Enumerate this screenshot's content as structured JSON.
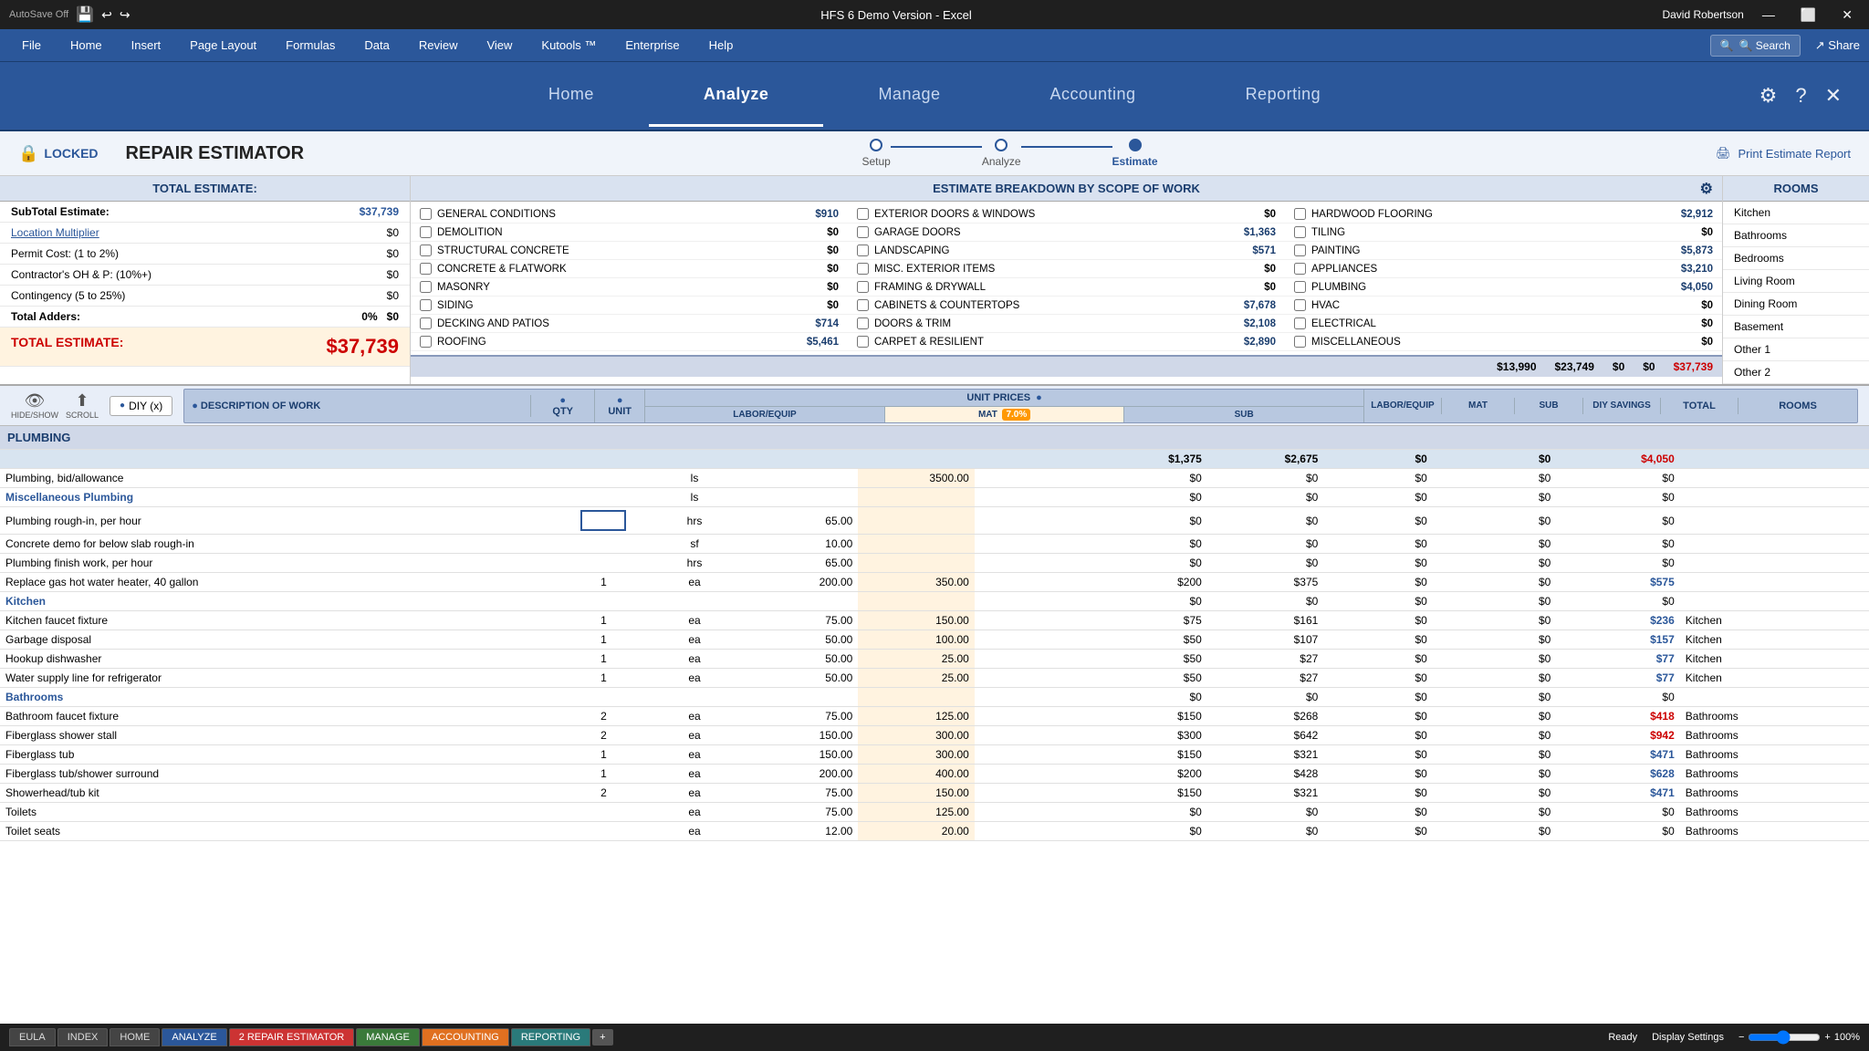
{
  "titlebar": {
    "autosave": "AutoSave  Off",
    "title": "HFS 6 Demo Version - Excel",
    "user": "David Robertson"
  },
  "ribbon": {
    "tabs": [
      "File",
      "Home",
      "Insert",
      "Page Layout",
      "Formulas",
      "Data",
      "Review",
      "View",
      "Kutools ™",
      "Enterprise",
      "Help"
    ],
    "search_placeholder": "Search",
    "search_label": "🔍 Search"
  },
  "app_nav": {
    "tabs": [
      "Home",
      "Analyze",
      "Manage",
      "Accounting",
      "Reporting"
    ],
    "active_tab": "Analyze",
    "icons": [
      "⚙",
      "?",
      "✕"
    ]
  },
  "header": {
    "locked_label": "LOCKED",
    "title": "REPAIR ESTIMATOR",
    "steps": [
      "Setup",
      "Analyze",
      "Estimate"
    ],
    "active_step": "Estimate",
    "print_label": "Print Estimate Report"
  },
  "summary": {
    "header": "TOTAL ESTIMATE:",
    "rows": [
      {
        "label": "SubTotal Estimate:",
        "value": "$37,739",
        "bold": true
      },
      {
        "label": "Location Multiplier",
        "value": "$0",
        "link": true
      },
      {
        "label": "Permit Cost: (1 to 2%)",
        "value": "$0"
      },
      {
        "label": "Contractor's  OH & P: (10%+)",
        "value": "$0"
      },
      {
        "label": "Contingency (5 to 25%)",
        "value": "$0"
      },
      {
        "label": "Total Adders:",
        "value": "0%   $0",
        "bold": true
      },
      {
        "label": "TOTAL ESTIMATE:",
        "value": "$37,739",
        "total": true
      }
    ]
  },
  "estimate_breakdown": {
    "header": "ESTIMATE BREAKDOWN BY SCOPE OF WORK",
    "items": [
      {
        "label": "GENERAL CONDITIONS",
        "value": "$910",
        "checked": false
      },
      {
        "label": "EXTERIOR DOORS & WINDOWS",
        "value": "$0",
        "checked": false
      },
      {
        "label": "HARDWOOD FLOORING",
        "value": "$2,912",
        "checked": false
      },
      {
        "label": "DEMOLITION",
        "value": "$0",
        "checked": false
      },
      {
        "label": "GARAGE DOORS",
        "value": "$1,363",
        "checked": false
      },
      {
        "label": "TILING",
        "value": "$0",
        "checked": false
      },
      {
        "label": "STRUCTURAL CONCRETE",
        "value": "$0",
        "checked": false
      },
      {
        "label": "LANDSCAPING",
        "value": "$571",
        "checked": false
      },
      {
        "label": "PAINTING",
        "value": "$5,873",
        "checked": false
      },
      {
        "label": "CONCRETE & FLATWORK",
        "value": "$0",
        "checked": false
      },
      {
        "label": "MISC. EXTERIOR ITEMS",
        "value": "$0",
        "checked": false
      },
      {
        "label": "APPLIANCES",
        "value": "$3,210",
        "checked": false
      },
      {
        "label": "MASONRY",
        "value": "$0",
        "checked": false
      },
      {
        "label": "FRAMING & DRYWALL",
        "value": "$0",
        "checked": false
      },
      {
        "label": "PLUMBING",
        "value": "$4,050",
        "checked": false
      },
      {
        "label": "SIDING",
        "value": "$0",
        "checked": false
      },
      {
        "label": "CABINETS & COUNTERTOPS",
        "value": "$7,678",
        "checked": false
      },
      {
        "label": "HVAC",
        "value": "$0",
        "checked": false
      },
      {
        "label": "DECKING AND PATIOS",
        "value": "$714",
        "checked": false
      },
      {
        "label": "DOORS & TRIM",
        "value": "$2,108",
        "checked": false
      },
      {
        "label": "ELECTRICAL",
        "value": "$0",
        "checked": false
      },
      {
        "label": "ROOFING",
        "value": "$5,461",
        "checked": false
      },
      {
        "label": "CARPET & RESILIENT",
        "value": "$2,890",
        "checked": false
      },
      {
        "label": "MISCELLANEOUS",
        "value": "$0",
        "checked": false
      }
    ],
    "totals": [
      "$13,990",
      "$23,749",
      "$0",
      "$0",
      "$37,739"
    ]
  },
  "rooms": {
    "header": "ROOMS",
    "items": [
      "Kitchen",
      "Bathrooms",
      "Bedrooms",
      "Living Room",
      "Dining Room",
      "Basement",
      "Other 1",
      "Other 2"
    ]
  },
  "toolbar": {
    "hide_show": "HIDE/SHOW",
    "scroll": "SCROLL",
    "diy_label": "DIY (x)",
    "desc_header": "DESCRIPTION OF WORK",
    "qty_header": "QTY",
    "unit_header": "UNIT",
    "unit_prices_header": "UNIT PRICES",
    "labor_equip_header": "LABOR/EQUIP",
    "mat_header": "MAT",
    "mat_pct": "7.0%",
    "sub_header": "SUB",
    "labor_equip2": "LABOR/EQUIP",
    "mat2": "MAT",
    "sub2": "SUB",
    "diy_savings": "DIY SAVINGS",
    "total": "TOTAL",
    "rooms2": "ROOMS"
  },
  "plumbing": {
    "section_label": "PLUMBING",
    "totals": {
      "labor": "$1,375",
      "mat": "$2,675",
      "sub": "$0",
      "diy": "$0",
      "total": "$4,050"
    },
    "rows": [
      {
        "desc": "Plumbing, bid/allowance",
        "qty": "",
        "unit": "ls",
        "le": "",
        "mat": "3500.00",
        "sub": "",
        "labor": "$0",
        "matv": "$0",
        "subv": "$0",
        "diyv": "$0",
        "totalv": "$0",
        "room": ""
      },
      {
        "desc": "Miscellaneous Plumbing",
        "qty": "",
        "unit": "ls",
        "le": "",
        "mat": "",
        "sub": "",
        "labor": "$0",
        "matv": "$0",
        "subv": "$0",
        "diyv": "$0",
        "totalv": "$0",
        "room": "",
        "subsection": true
      },
      {
        "desc": "Plumbing rough-in, per hour",
        "qty": "",
        "unit": "hrs",
        "le": "65.00",
        "mat": "",
        "sub": "",
        "labor": "$0",
        "matv": "$0",
        "subv": "$0",
        "diyv": "$0",
        "totalv": "$0",
        "room": "",
        "input": true
      },
      {
        "desc": "Concrete demo for below slab rough-in",
        "qty": "",
        "unit": "sf",
        "le": "10.00",
        "mat": "",
        "sub": "",
        "labor": "$0",
        "matv": "$0",
        "subv": "$0",
        "diyv": "$0",
        "totalv": "$0",
        "room": ""
      },
      {
        "desc": "Plumbing finish work, per hour",
        "qty": "",
        "unit": "hrs",
        "le": "65.00",
        "mat": "",
        "sub": "",
        "labor": "$0",
        "matv": "$0",
        "subv": "$0",
        "diyv": "$0",
        "totalv": "$0",
        "room": ""
      },
      {
        "desc": "Replace gas hot water heater, 40 gallon",
        "qty": "1",
        "unit": "ea",
        "le": "200.00",
        "mat": "350.00",
        "sub": "",
        "labor": "$200",
        "matv": "$375",
        "subv": "$0",
        "diyv": "$0",
        "totalv": "$575",
        "room": ""
      },
      {
        "desc": "Kitchen",
        "qty": "",
        "unit": "",
        "le": "",
        "mat": "",
        "sub": "",
        "labor": "$0",
        "matv": "$0",
        "subv": "$0",
        "diyv": "$0",
        "totalv": "$0",
        "room": "",
        "subsection": true
      },
      {
        "desc": "Kitchen faucet fixture",
        "qty": "1",
        "unit": "ea",
        "le": "75.00",
        "mat": "150.00",
        "sub": "",
        "labor": "$75",
        "matv": "$161",
        "subv": "$0",
        "diyv": "$0",
        "totalv": "$236",
        "room": "Kitchen"
      },
      {
        "desc": "Garbage disposal",
        "qty": "1",
        "unit": "ea",
        "le": "50.00",
        "mat": "100.00",
        "sub": "",
        "labor": "$50",
        "matv": "$107",
        "subv": "$0",
        "diyv": "$0",
        "totalv": "$157",
        "room": "Kitchen"
      },
      {
        "desc": "Hookup dishwasher",
        "qty": "1",
        "unit": "ea",
        "le": "50.00",
        "mat": "25.00",
        "sub": "",
        "labor": "$50",
        "matv": "$27",
        "subv": "$0",
        "diyv": "$0",
        "totalv": "$77",
        "room": "Kitchen"
      },
      {
        "desc": "Water supply line for refrigerator",
        "qty": "1",
        "unit": "ea",
        "le": "50.00",
        "mat": "25.00",
        "sub": "",
        "labor": "$50",
        "matv": "$27",
        "subv": "$0",
        "diyv": "$0",
        "totalv": "$77",
        "room": "Kitchen"
      },
      {
        "desc": "Bathrooms",
        "qty": "",
        "unit": "",
        "le": "",
        "mat": "",
        "sub": "",
        "labor": "$0",
        "matv": "$0",
        "subv": "$0",
        "diyv": "$0",
        "totalv": "$0",
        "room": "",
        "subsection": true
      },
      {
        "desc": "Bathroom faucet fixture",
        "qty": "2",
        "unit": "ea",
        "le": "75.00",
        "mat": "125.00",
        "sub": "",
        "labor": "$150",
        "matv": "$268",
        "subv": "$0",
        "diyv": "$0",
        "totalv": "$418",
        "room": "Bathrooms"
      },
      {
        "desc": "Fiberglass shower stall",
        "qty": "2",
        "unit": "ea",
        "le": "150.00",
        "mat": "300.00",
        "sub": "",
        "labor": "$300",
        "matv": "$642",
        "subv": "$0",
        "diyv": "$0",
        "totalv": "$942",
        "room": "Bathrooms"
      },
      {
        "desc": "Fiberglass tub",
        "qty": "1",
        "unit": "ea",
        "le": "150.00",
        "mat": "300.00",
        "sub": "",
        "labor": "$150",
        "matv": "$321",
        "subv": "$0",
        "diyv": "$0",
        "totalv": "$471",
        "room": "Bathrooms"
      },
      {
        "desc": "Fiberglass tub/shower surround",
        "qty": "1",
        "unit": "ea",
        "le": "200.00",
        "mat": "400.00",
        "sub": "",
        "labor": "$200",
        "matv": "$428",
        "subv": "$0",
        "diyv": "$0",
        "totalv": "$628",
        "room": "Bathrooms"
      },
      {
        "desc": "Showerhead/tub kit",
        "qty": "2",
        "unit": "ea",
        "le": "75.00",
        "mat": "150.00",
        "sub": "",
        "labor": "$150",
        "matv": "$321",
        "subv": "$0",
        "diyv": "$0",
        "totalv": "$471",
        "room": "Bathrooms"
      },
      {
        "desc": "Toilets",
        "qty": "",
        "unit": "ea",
        "le": "75.00",
        "mat": "125.00",
        "sub": "",
        "labor": "$0",
        "matv": "$0",
        "subv": "$0",
        "diyv": "$0",
        "totalv": "$0",
        "room": "Bathrooms"
      },
      {
        "desc": "Toilet seats",
        "qty": "",
        "unit": "ea",
        "le": "12.00",
        "mat": "20.00",
        "sub": "",
        "labor": "$0",
        "matv": "$0",
        "subv": "$0",
        "diyv": "$0",
        "totalv": "$0",
        "room": "Bathrooms"
      }
    ]
  },
  "bottom_tabs": {
    "tabs": [
      "EULA",
      "INDEX",
      "HOME",
      "ANALYZE",
      "2 REPAIR ESTIMATOR",
      "MANAGE",
      "ACCOUNTING",
      "REPORTING"
    ],
    "active": "2 REPAIR ESTIMATOR",
    "colors": [
      "gray",
      "gray",
      "gray",
      "blue",
      "red",
      "green-tab",
      "orange",
      "teal"
    ]
  },
  "status": {
    "ready": "Ready",
    "display_settings": "Display Settings",
    "zoom": "100%"
  }
}
